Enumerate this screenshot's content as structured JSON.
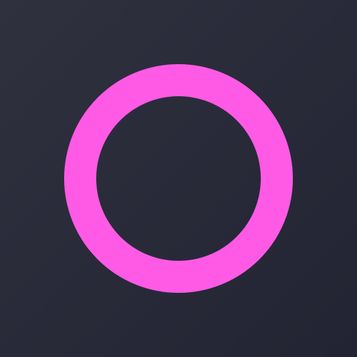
{
  "colors": {
    "background_start": "#30313f",
    "background_end": "#222433",
    "ring": "#ff5ae6"
  },
  "icon": {
    "name": "circle-outline-icon"
  }
}
